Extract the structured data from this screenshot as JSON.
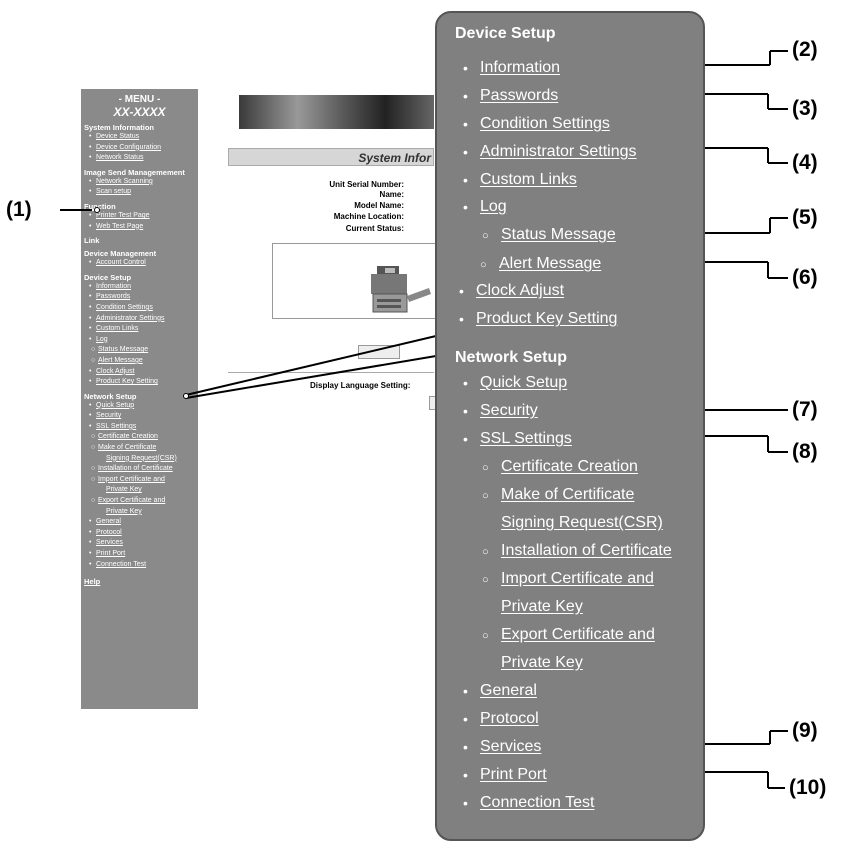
{
  "menu": {
    "header": "- MENU -",
    "model": "XX-XXXX",
    "sections": [
      {
        "title": "System Information",
        "items": [
          {
            "label": "Device Status",
            "level": 1
          },
          {
            "label": "Device Configuration",
            "level": 1
          },
          {
            "label": "Network Status",
            "level": 1
          }
        ]
      },
      {
        "title": "Image Send Managemement",
        "items": [
          {
            "label": "Network Scanning",
            "level": 1
          },
          {
            "label": "Scan setup",
            "level": 1
          }
        ]
      },
      {
        "title": "Function",
        "items": [
          {
            "label": "Printer Test Page",
            "level": 1
          },
          {
            "label": "Web Test Page",
            "level": 1
          }
        ]
      },
      {
        "title": "Link",
        "items": []
      },
      {
        "title": "Device Management",
        "items": [
          {
            "label": "Account Control",
            "level": 1
          }
        ]
      },
      {
        "title": "Device Setup",
        "items": [
          {
            "label": "Information",
            "level": 1
          },
          {
            "label": "Passwords",
            "level": 1
          },
          {
            "label": "Condition Settings",
            "level": 1
          },
          {
            "label": "Administrator Settings",
            "level": 1
          },
          {
            "label": "Custom Links",
            "level": 1
          },
          {
            "label": "Log",
            "level": 1
          },
          {
            "label": "Status Message",
            "level": 2
          },
          {
            "label": "Alert Message",
            "level": 2
          },
          {
            "label": "Clock Adjust",
            "level": 1
          },
          {
            "label": "Product Key Setting",
            "level": 1
          }
        ]
      },
      {
        "title": "Network Setup",
        "items": [
          {
            "label": "Quick Setup",
            "level": 1
          },
          {
            "label": "Security",
            "level": 1
          },
          {
            "label": "SSL Settings",
            "level": 1
          },
          {
            "label": "Certificate Creation",
            "level": 2
          },
          {
            "label": "Make of Certificate",
            "level": 2
          },
          {
            "label": "Signing Request(CSR)",
            "level": 3
          },
          {
            "label": "Installation of Certificate",
            "level": 2
          },
          {
            "label": "Import Certificate and",
            "level": 2
          },
          {
            "label": "Private Key",
            "level": 3
          },
          {
            "label": "Export Certificate and",
            "level": 2
          },
          {
            "label": "Private Key",
            "level": 3
          },
          {
            "label": "General",
            "level": 1
          },
          {
            "label": "Protocol",
            "level": 1
          },
          {
            "label": "Services",
            "level": 1
          },
          {
            "label": "Print Port",
            "level": 1
          },
          {
            "label": "Connection Test",
            "level": 1
          }
        ]
      }
    ],
    "help": "Help"
  },
  "screen": {
    "title": "System Infor",
    "fields": [
      "Unit Serial Number:",
      "Name:",
      "Model Name:",
      "Machine Location:",
      "Current Status:"
    ],
    "display_language": "Display Language Setting:"
  },
  "panel": {
    "device_setup_title": "Device Setup",
    "device_setup": [
      "Information",
      "Passwords",
      "Condition Settings",
      "Administrator Settings",
      "Custom Links",
      "Log"
    ],
    "log_sub": [
      "Status Message",
      "Alert Message"
    ],
    "device_setup_tail": [
      "Clock Adjust",
      "Product Key Setting"
    ],
    "network_setup_title": "Network Setup",
    "network_setup": [
      "Quick Setup",
      "Security",
      "SSL Settings"
    ],
    "ssl_sub": [
      "Certificate Creation",
      "Make of Certificate",
      "Signing Request(CSR)",
      "Installation of Certificate",
      "Import Certificate and",
      "Private Key",
      "Export Certificate and",
      "Private Key"
    ],
    "network_setup_tail": [
      "General",
      "Protocol",
      "Services",
      "Print Port",
      "Connection Test"
    ]
  },
  "callouts": [
    "(1)",
    "(2)",
    "(3)",
    "(4)",
    "(5)",
    "(6)",
    "(7)",
    "(8)",
    "(9)",
    "(10)"
  ]
}
